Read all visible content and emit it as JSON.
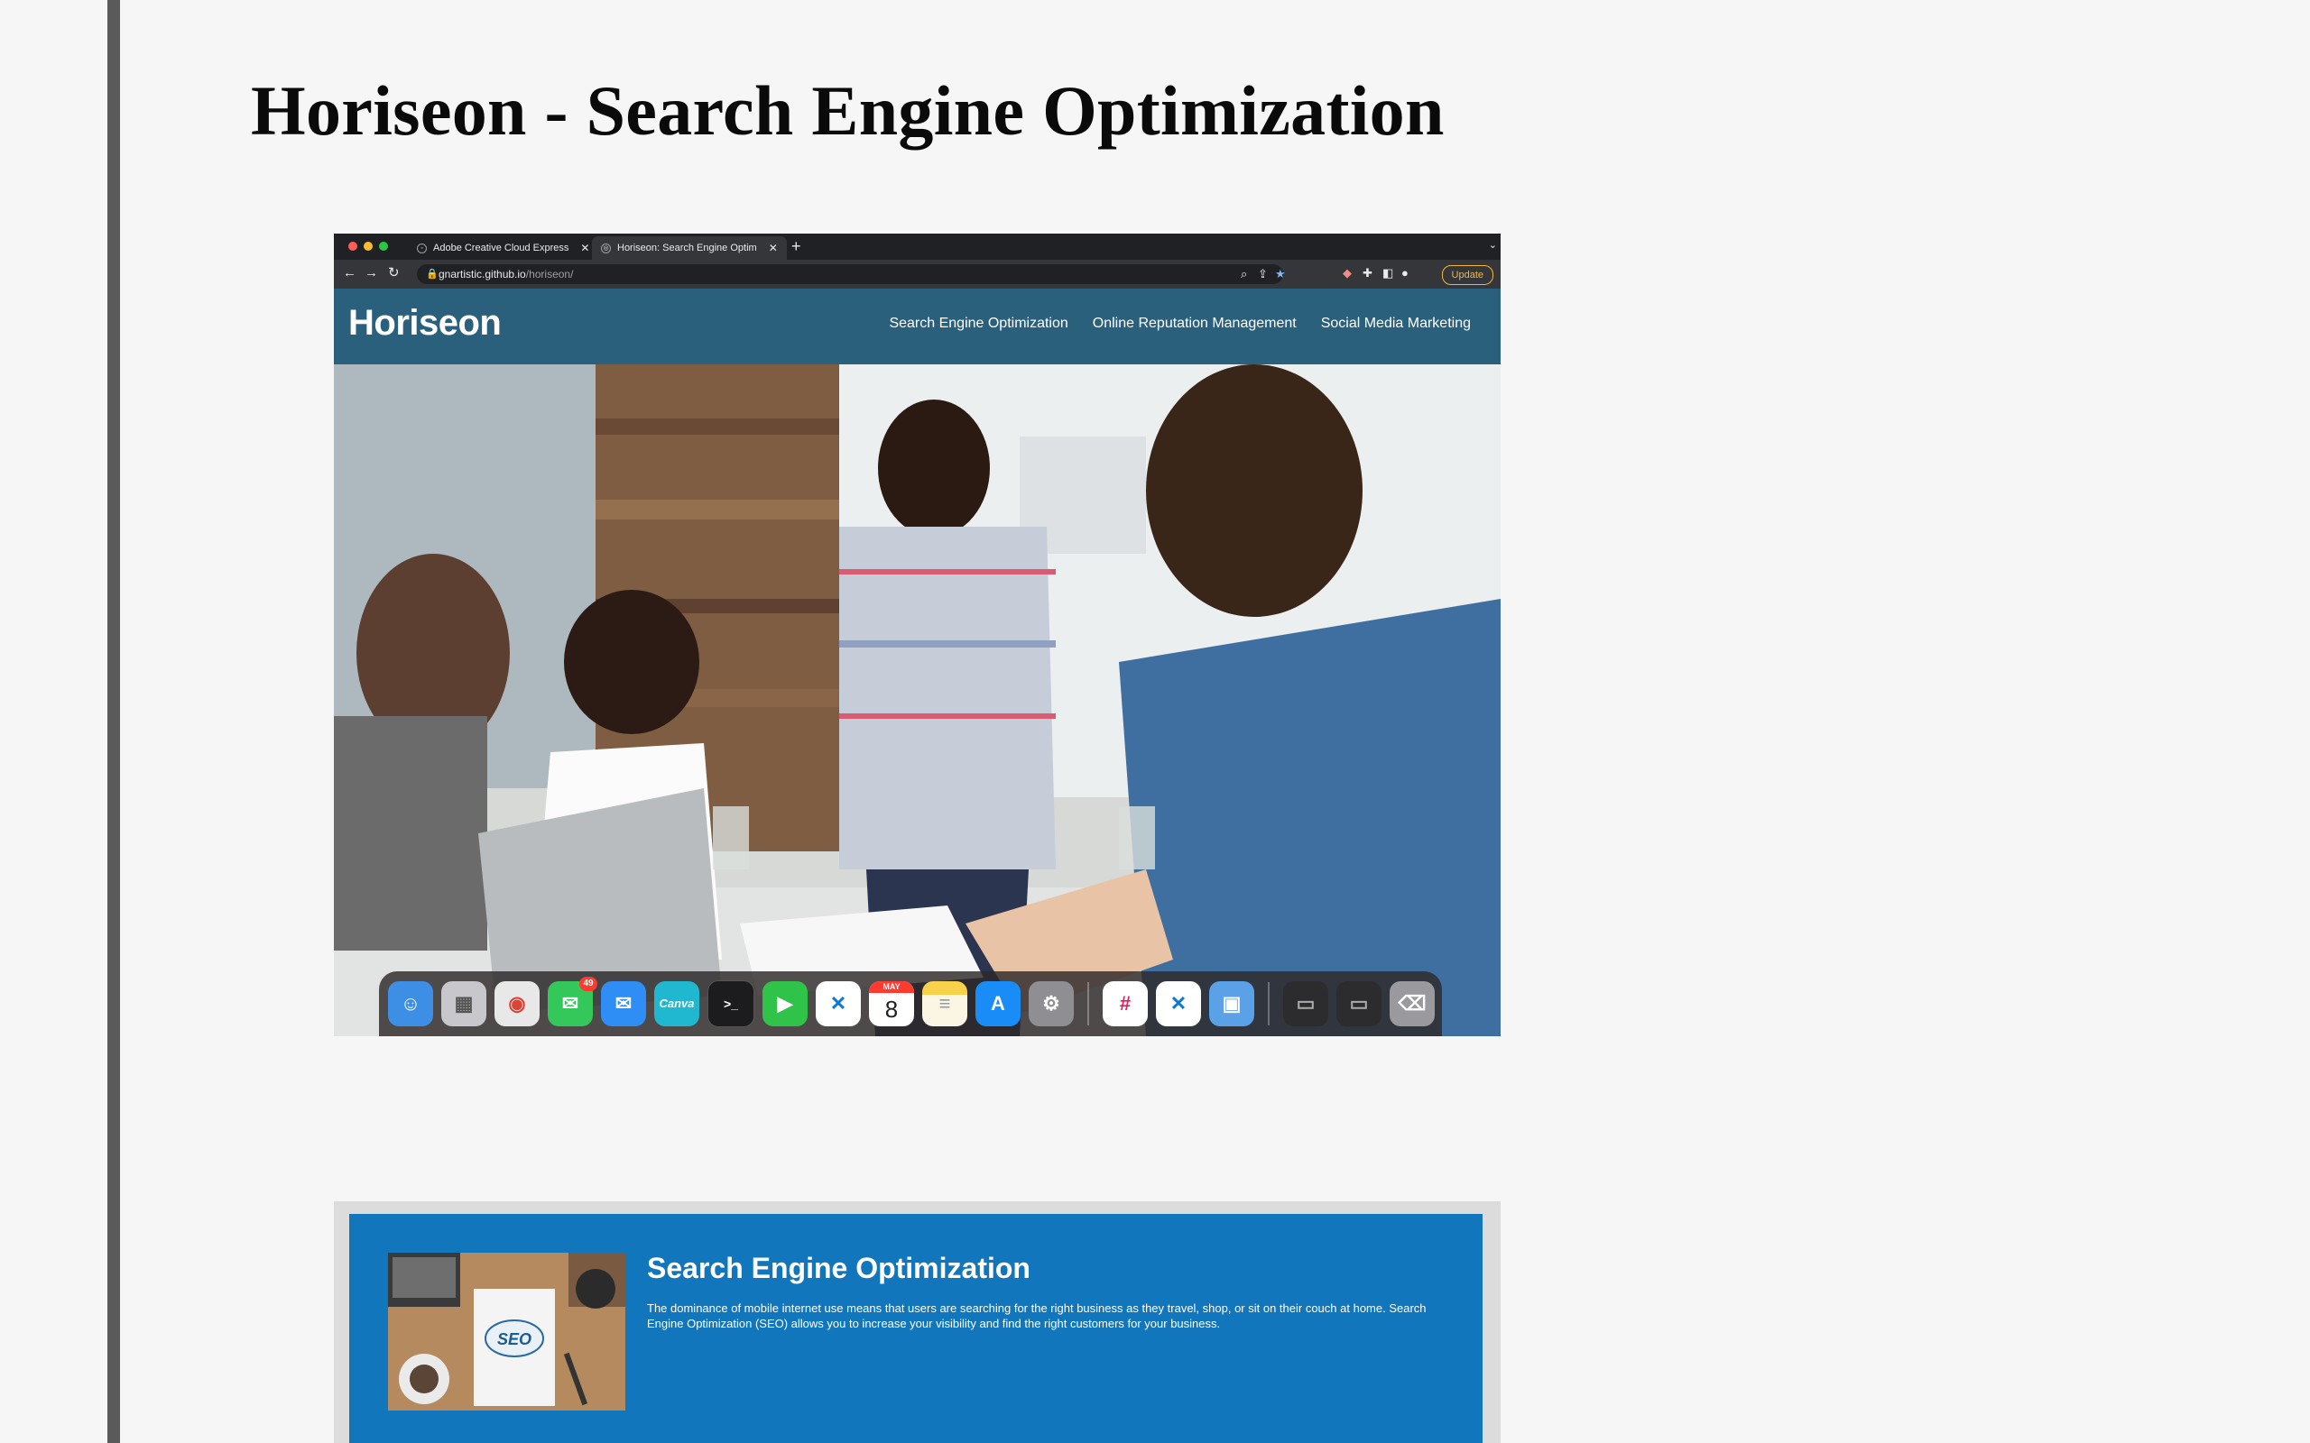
{
  "page": {
    "title": "Horiseon - Search Engine Optimization"
  },
  "browser": {
    "tabs": [
      {
        "label": "Adobe Creative Cloud Express",
        "active": false
      },
      {
        "label": "Horiseon: Search Engine Optim",
        "active": true
      }
    ],
    "new_tab_symbol": "+",
    "url_host": "gnartistic.github.io",
    "url_path": "/horiseon/",
    "update_label": "Update"
  },
  "site": {
    "logo": "Horiseon",
    "nav": [
      "Search Engine Optimization",
      "Online Reputation Management",
      "Social Media Marketing"
    ]
  },
  "dock": {
    "apps": [
      {
        "name": "finder",
        "color": "#3d8fe6",
        "glyph": "☺"
      },
      {
        "name": "launchpad",
        "color": "#c7c7cc",
        "glyph": "▦"
      },
      {
        "name": "chrome",
        "color": "#e8e8e8",
        "glyph": "◉"
      },
      {
        "name": "messages",
        "color": "#34c759",
        "glyph": "💬",
        "badge": "49"
      },
      {
        "name": "mail",
        "color": "#2f8ef5",
        "glyph": "✉"
      },
      {
        "name": "canva",
        "color": "#20b8d0",
        "glyph": "Canva"
      },
      {
        "name": "terminal",
        "color": "#1c1c1e",
        "glyph": ">_"
      },
      {
        "name": "facetime",
        "color": "#30c34a",
        "glyph": "▶"
      },
      {
        "name": "vscode",
        "color": "#0a78d4",
        "glyph": "⟩⟨"
      },
      {
        "name": "calendar",
        "color": "#ffffff",
        "month": "MAY",
        "day": "8"
      },
      {
        "name": "notes",
        "color": "#f7d24a",
        "glyph": "≡"
      },
      {
        "name": "app-store",
        "color": "#1a8cf7",
        "glyph": "A"
      },
      {
        "name": "system-preferences",
        "color": "#8e8e93",
        "glyph": "⚙"
      }
    ],
    "apps_2": [
      {
        "name": "slack",
        "color": "#ffffff",
        "glyph": "#"
      },
      {
        "name": "vscode-2",
        "color": "#0a78d4",
        "glyph": "⟩⟨"
      },
      {
        "name": "preview",
        "color": "#5aa1e8",
        "glyph": "▣"
      }
    ],
    "apps_3": [
      {
        "name": "recent-window-1",
        "color": "#2c2c2e",
        "glyph": "▭"
      },
      {
        "name": "recent-window-2",
        "color": "#2c2c2e",
        "glyph": "▭"
      },
      {
        "name": "trash",
        "color": "#9a9a9e",
        "glyph": "🗑"
      }
    ]
  },
  "seo_card": {
    "title": "Search Engine Optimization",
    "text": "The dominance of mobile internet use means that users are searching for the right business as they travel, shop, or sit on their couch at home. Search Engine Optimization (SEO) allows you to increase your visibility and find the right customers for your business.",
    "image_label": "SEO"
  }
}
